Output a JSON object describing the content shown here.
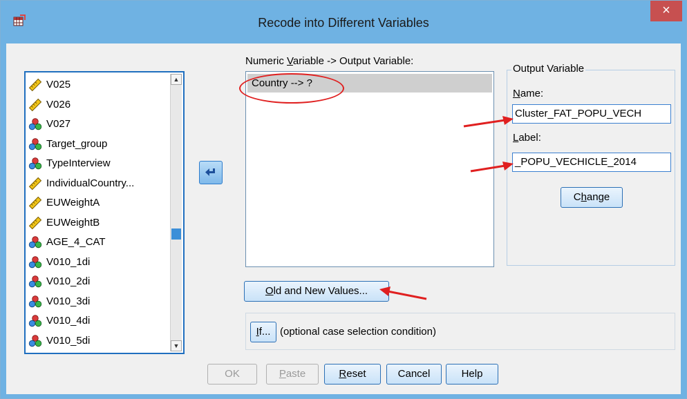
{
  "window": {
    "title": "Recode into Different Variables",
    "close_label": "×",
    "app_icon": "spss-table-icon"
  },
  "variables": [
    {
      "name": "V025",
      "icon": "scale-ruler-icon"
    },
    {
      "name": "V026",
      "icon": "scale-ruler-icon"
    },
    {
      "name": "V027",
      "icon": "nominal-icon"
    },
    {
      "name": "Target_group",
      "icon": "nominal-icon"
    },
    {
      "name": "TypeInterview",
      "icon": "nominal-icon"
    },
    {
      "name": "IndividualCountry...",
      "icon": "scale-ruler-icon"
    },
    {
      "name": "EUWeightA",
      "icon": "scale-ruler-icon"
    },
    {
      "name": "EUWeightB",
      "icon": "scale-ruler-icon"
    },
    {
      "name": "AGE_4_CAT",
      "icon": "nominal-icon"
    },
    {
      "name": "V010_1di",
      "icon": "nominal-icon"
    },
    {
      "name": "V010_2di",
      "icon": "nominal-icon"
    },
    {
      "name": "V010_3di",
      "icon": "nominal-icon"
    },
    {
      "name": "V010_4di",
      "icon": "nominal-icon"
    },
    {
      "name": "V010_5di",
      "icon": "nominal-icon"
    }
  ],
  "scroll": {
    "up": "▲",
    "down": "▼"
  },
  "mapping": {
    "label_prefix": "Numeric ",
    "label_accel": "V",
    "label_suffix": "ariable -> Output Variable:",
    "items": [
      "Country --> ?"
    ]
  },
  "output_variable": {
    "group_title": "Output Variable",
    "name_accel": "N",
    "name_rest": "ame:",
    "name_value": "Cluster_FAT_POPU_VECH",
    "label_accel": "L",
    "label_rest": "abel:",
    "label_value": "_POPU_VECHICLE_2014",
    "change_pre": "C",
    "change_accel": "h",
    "change_rest": "ange"
  },
  "old_new": {
    "accel": "O",
    "rest": "ld and New Values..."
  },
  "if_section": {
    "accel": "I",
    "rest": "f...",
    "description": "(optional case selection condition)"
  },
  "buttons": {
    "ok": "OK",
    "paste_accel": "P",
    "paste_rest": "aste",
    "reset_accel": "R",
    "reset_rest": "eset",
    "cancel": "Cancel",
    "help": "Help"
  },
  "colors": {
    "title_bar": "#6fb2e3",
    "close": "#c75050",
    "annotation": "#e02020",
    "selection": "#cfcfcf"
  }
}
